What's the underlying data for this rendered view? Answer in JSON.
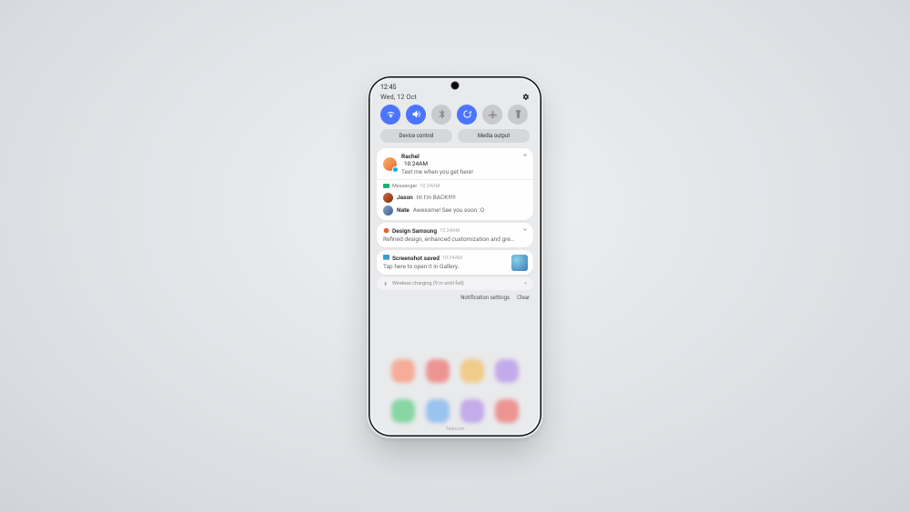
{
  "status": {
    "time": "12:45",
    "date": "Wed, 12 Oct"
  },
  "chips": {
    "device": "Device control",
    "media": "Media output"
  },
  "notif_rachel": {
    "name": "Rachel",
    "time": "10:24AM",
    "body": "Text me when you get here!"
  },
  "notif_messenger": {
    "app": "Messenger",
    "time": "10:24AM",
    "m1_name": "Jason",
    "m1_text": "Hi I'm BACK!!!!!",
    "m2_name": "Nate",
    "m2_text": "Awesome! See you soon :O"
  },
  "notif_design": {
    "title": "Design Samsung",
    "time": "10:24AM",
    "body": "Refined design, enhanced customization and gre…"
  },
  "notif_shot": {
    "title": "Screenshot saved",
    "time": "10:24AM",
    "body": "Tap here to open it in Gallery."
  },
  "notif_charge": {
    "text": "Wireless charging (9 m until full)"
  },
  "footer": {
    "settings": "Notification settings",
    "clear": "Clear"
  },
  "carrier": "Telecom"
}
